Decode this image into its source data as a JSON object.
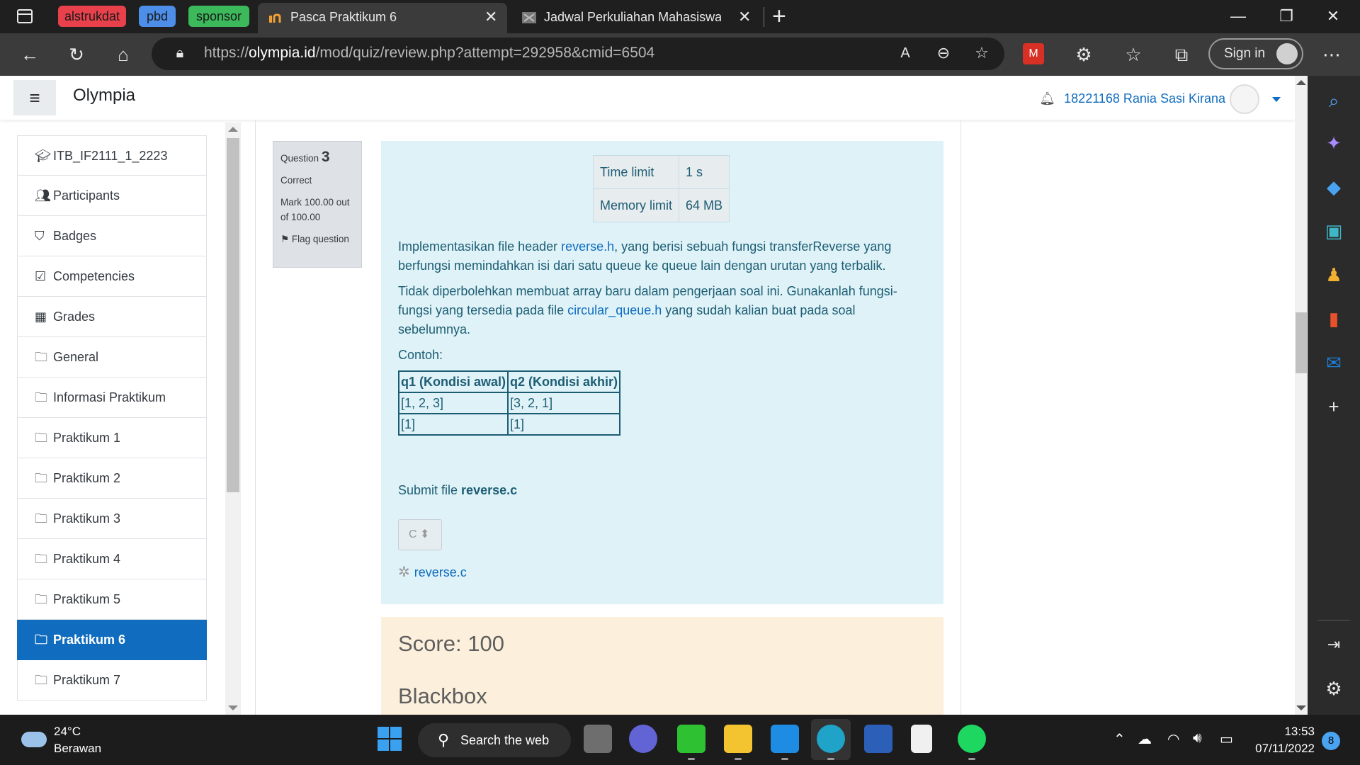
{
  "browser": {
    "tab_groups": [
      {
        "label": "alstrukdat",
        "color": "#e8414b"
      },
      {
        "label": "pbd",
        "color": "#4c8ee8"
      },
      {
        "label": "sponsor",
        "color": "#3cb95a"
      }
    ],
    "tabs": [
      {
        "title": "Pasca Praktikum 6",
        "active": true
      },
      {
        "title": "Jadwal Perkuliahan Mahasiswa | S",
        "active": false
      }
    ],
    "url_prefix": "https://",
    "url_domain": "olympia.id",
    "url_path": "/mod/quiz/review.php?attempt=292958&cmid=6504",
    "sign_in_label": "Sign in"
  },
  "site": {
    "brand": "Olympia",
    "user_name": "18221168 Rania Sasi Kirana"
  },
  "drawer": {
    "items": [
      {
        "label": "ITB_IF2111_1_2223",
        "icon": "graduation-cap-icon"
      },
      {
        "label": "Participants",
        "icon": "users-icon"
      },
      {
        "label": "Badges",
        "icon": "shield-icon"
      },
      {
        "label": "Competencies",
        "icon": "check-square-icon"
      },
      {
        "label": "Grades",
        "icon": "table-icon"
      },
      {
        "label": "General",
        "icon": "folder-icon"
      },
      {
        "label": "Informasi Praktikum",
        "icon": "folder-icon"
      },
      {
        "label": "Praktikum 1",
        "icon": "folder-icon"
      },
      {
        "label": "Praktikum 2",
        "icon": "folder-icon"
      },
      {
        "label": "Praktikum 3",
        "icon": "folder-icon"
      },
      {
        "label": "Praktikum 4",
        "icon": "folder-icon"
      },
      {
        "label": "Praktikum 5",
        "icon": "folder-icon"
      },
      {
        "label": "Praktikum 6",
        "icon": "folder-icon",
        "active": true
      },
      {
        "label": "Praktikum 7",
        "icon": "folder-icon"
      }
    ]
  },
  "question": {
    "label": "Question",
    "number": "3",
    "status": "Correct",
    "mark": "Mark 100.00 out of 100.00",
    "flag_label": "Flag question",
    "limits": [
      {
        "name": "Time limit",
        "value": "1 s"
      },
      {
        "name": "Memory limit",
        "value": "64 MB"
      }
    ],
    "p1_before": "Implementasikan file header ",
    "p1_link": "reverse.h",
    "p1_after": ", yang berisi sebuah fungsi transferReverse yang berfungsi memindahkan isi dari satu queue ke queue lain dengan urutan yang terbalik.",
    "p2_before": "Tidak diperbolehkan membuat array baru dalam pengerjaan soal ini. Gunakanlah fungsi-fungsi yang tersedia pada file ",
    "p2_link": "circular_queue.h",
    "p2_after": " yang sudah kalian buat pada soal sebelumnya.",
    "p3": "Contoh:",
    "example": {
      "headers": [
        "q1 (Kondisi awal)",
        "q2 (Kondisi akhir)"
      ],
      "rows": [
        [
          "[1, 2, 3]",
          "[3, 2, 1]"
        ],
        [
          "[1]",
          "[1]"
        ]
      ]
    },
    "submit_prefix": "Submit file ",
    "submit_file": "reverse.c",
    "language": "C",
    "uploaded_file": "reverse.c"
  },
  "feedback": {
    "score": "Score: 100",
    "section": "Blackbox"
  },
  "taskbar": {
    "temperature": "24°C",
    "weather": "Berawan",
    "search_label": "Search the web",
    "time": "13:53",
    "date": "07/11/2022",
    "notifications": "8"
  }
}
